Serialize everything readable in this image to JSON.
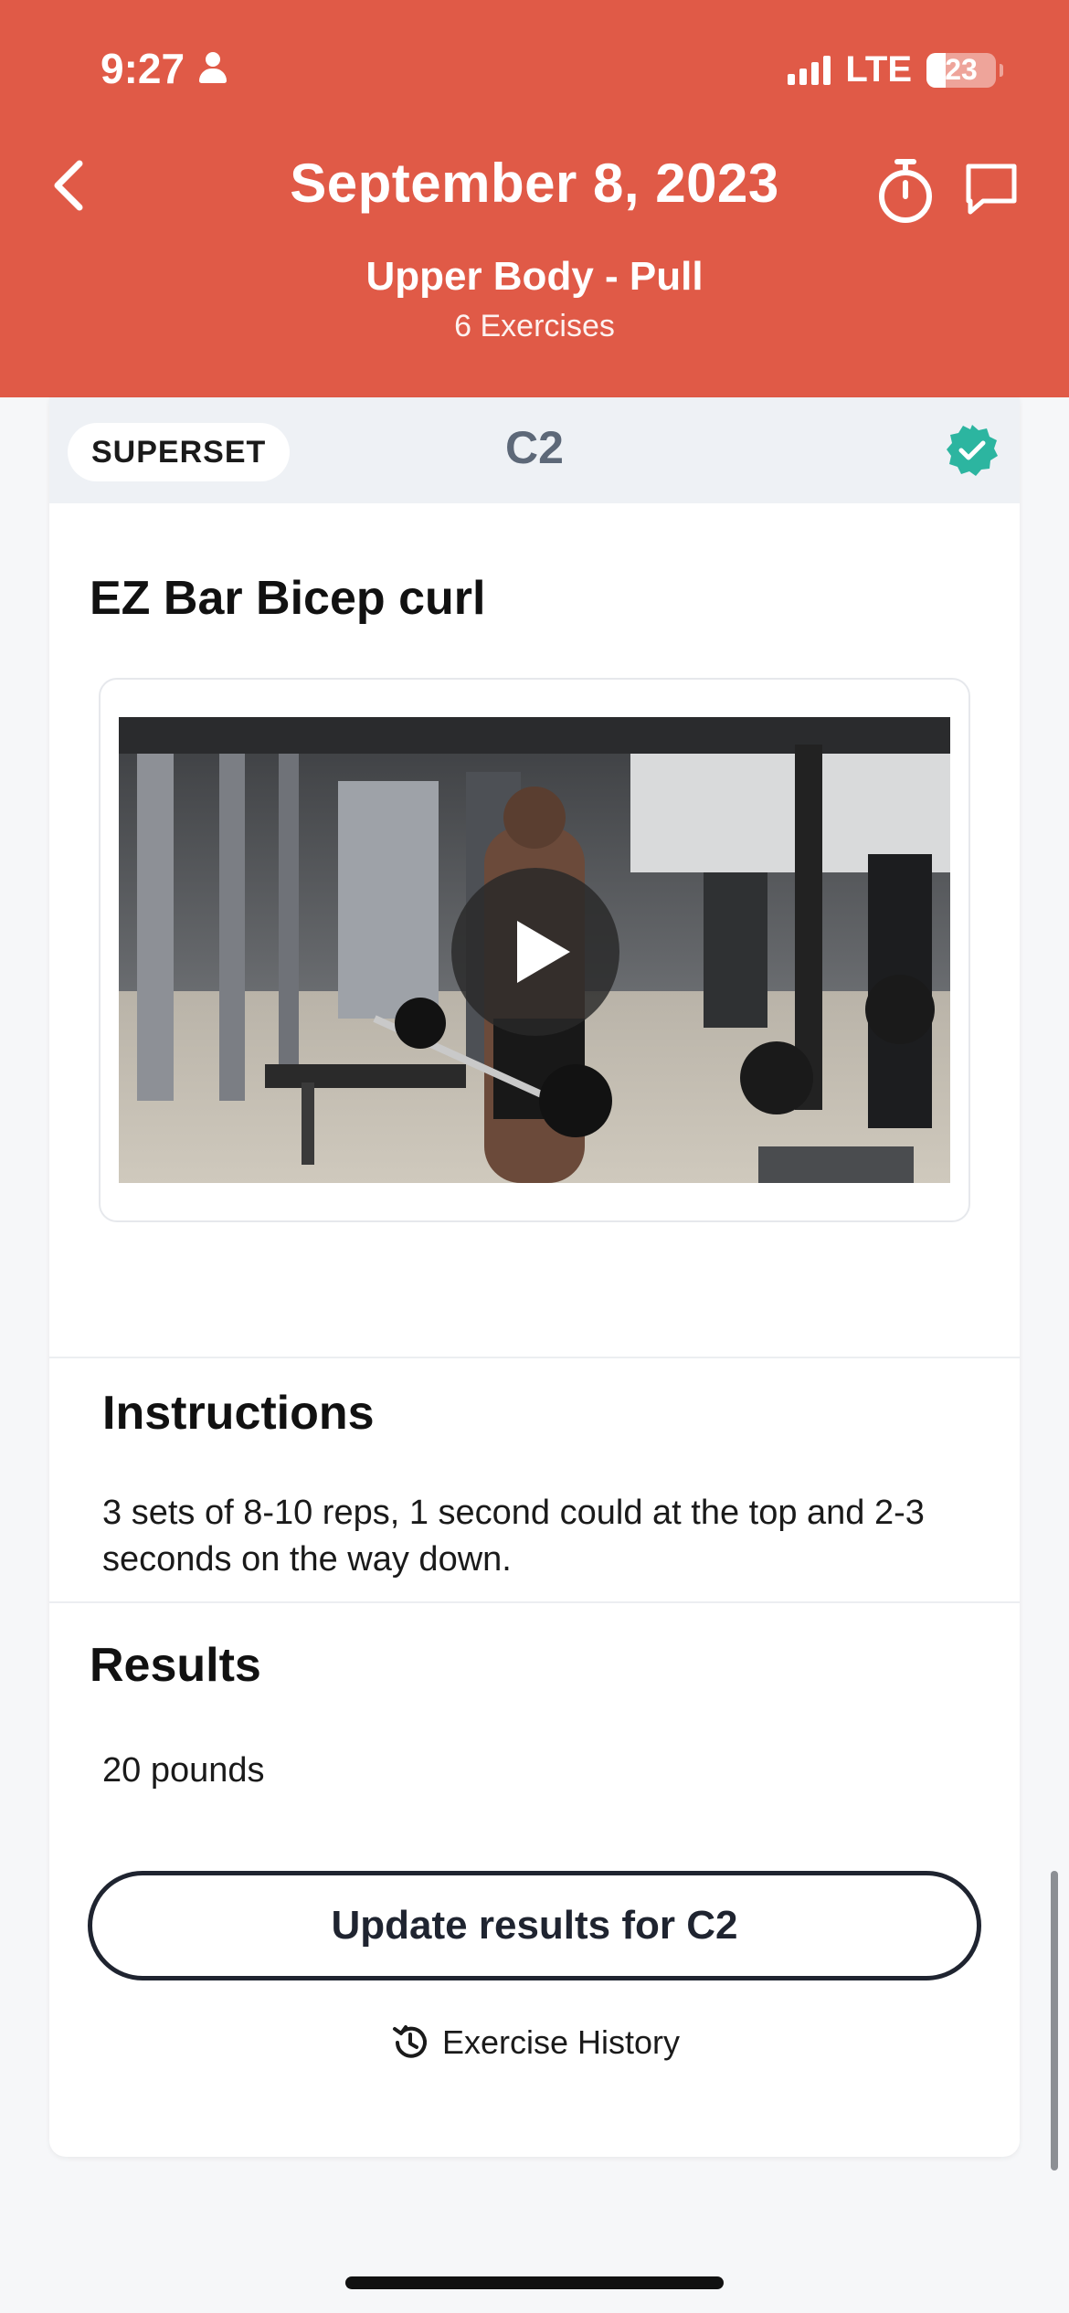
{
  "status_bar": {
    "time": "9:27",
    "network": "LTE",
    "battery": "23"
  },
  "header": {
    "title": "September 8, 2023",
    "subtitle": "Upper Body - Pull",
    "count": "6 Exercises"
  },
  "superset": {
    "pill": "SUPERSET",
    "group": "C2"
  },
  "exercise": {
    "title": "EZ Bar Bicep curl"
  },
  "instructions": {
    "title": "Instructions",
    "text": "3 sets of 8-10 reps, 1 second could at the top and 2-3 seconds on the way down."
  },
  "results": {
    "title": "Results",
    "value": "20 pounds",
    "update_button": "Update results for C2",
    "history_link": "Exercise History"
  },
  "colors": {
    "header": "#e05a47",
    "verified": "#2cb5a0",
    "button_border": "#1f2430"
  }
}
